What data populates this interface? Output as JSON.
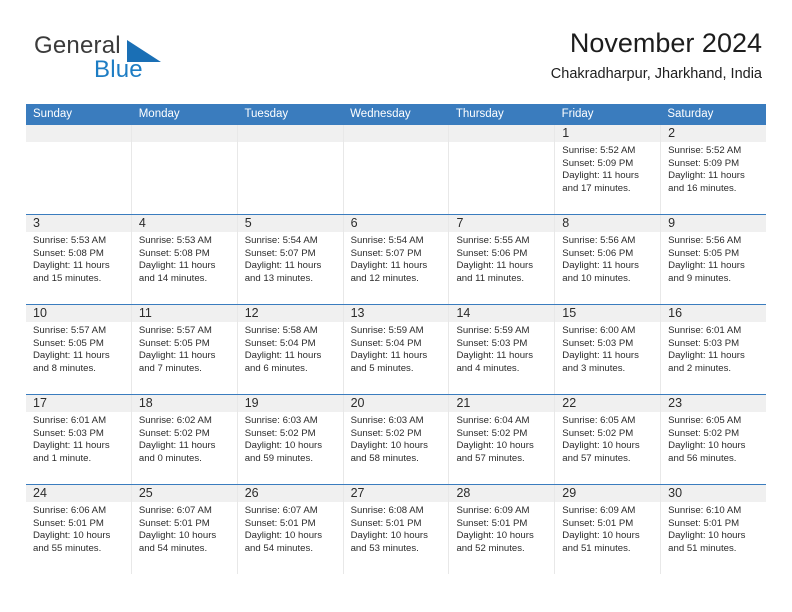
{
  "brand": {
    "word_general": "General",
    "word_blue": "Blue",
    "logo_icon": "triangle-icon"
  },
  "header": {
    "title": "November 2024",
    "subtitle": "Chakradharpur, Jharkhand, India"
  },
  "theme": {
    "header_blue": "#3a7cbe",
    "brand_blue": "#1d7dc4",
    "day_band_gray": "#f0f0f0",
    "cell_border": "#e8e8e8",
    "text": "#2b2b2b"
  },
  "weekdays": [
    "Sunday",
    "Monday",
    "Tuesday",
    "Wednesday",
    "Thursday",
    "Friday",
    "Saturday"
  ],
  "weeks": [
    [
      {
        "day": "",
        "sunrise": "",
        "sunset": "",
        "daylight1": "",
        "daylight2": ""
      },
      {
        "day": "",
        "sunrise": "",
        "sunset": "",
        "daylight1": "",
        "daylight2": ""
      },
      {
        "day": "",
        "sunrise": "",
        "sunset": "",
        "daylight1": "",
        "daylight2": ""
      },
      {
        "day": "",
        "sunrise": "",
        "sunset": "",
        "daylight1": "",
        "daylight2": ""
      },
      {
        "day": "",
        "sunrise": "",
        "sunset": "",
        "daylight1": "",
        "daylight2": ""
      },
      {
        "day": "1",
        "sunrise": "Sunrise: 5:52 AM",
        "sunset": "Sunset: 5:09 PM",
        "daylight1": "Daylight: 11 hours",
        "daylight2": "and 17 minutes."
      },
      {
        "day": "2",
        "sunrise": "Sunrise: 5:52 AM",
        "sunset": "Sunset: 5:09 PM",
        "daylight1": "Daylight: 11 hours",
        "daylight2": "and 16 minutes."
      }
    ],
    [
      {
        "day": "3",
        "sunrise": "Sunrise: 5:53 AM",
        "sunset": "Sunset: 5:08 PM",
        "daylight1": "Daylight: 11 hours",
        "daylight2": "and 15 minutes."
      },
      {
        "day": "4",
        "sunrise": "Sunrise: 5:53 AM",
        "sunset": "Sunset: 5:08 PM",
        "daylight1": "Daylight: 11 hours",
        "daylight2": "and 14 minutes."
      },
      {
        "day": "5",
        "sunrise": "Sunrise: 5:54 AM",
        "sunset": "Sunset: 5:07 PM",
        "daylight1": "Daylight: 11 hours",
        "daylight2": "and 13 minutes."
      },
      {
        "day": "6",
        "sunrise": "Sunrise: 5:54 AM",
        "sunset": "Sunset: 5:07 PM",
        "daylight1": "Daylight: 11 hours",
        "daylight2": "and 12 minutes."
      },
      {
        "day": "7",
        "sunrise": "Sunrise: 5:55 AM",
        "sunset": "Sunset: 5:06 PM",
        "daylight1": "Daylight: 11 hours",
        "daylight2": "and 11 minutes."
      },
      {
        "day": "8",
        "sunrise": "Sunrise: 5:56 AM",
        "sunset": "Sunset: 5:06 PM",
        "daylight1": "Daylight: 11 hours",
        "daylight2": "and 10 minutes."
      },
      {
        "day": "9",
        "sunrise": "Sunrise: 5:56 AM",
        "sunset": "Sunset: 5:05 PM",
        "daylight1": "Daylight: 11 hours",
        "daylight2": "and 9 minutes."
      }
    ],
    [
      {
        "day": "10",
        "sunrise": "Sunrise: 5:57 AM",
        "sunset": "Sunset: 5:05 PM",
        "daylight1": "Daylight: 11 hours",
        "daylight2": "and 8 minutes."
      },
      {
        "day": "11",
        "sunrise": "Sunrise: 5:57 AM",
        "sunset": "Sunset: 5:05 PM",
        "daylight1": "Daylight: 11 hours",
        "daylight2": "and 7 minutes."
      },
      {
        "day": "12",
        "sunrise": "Sunrise: 5:58 AM",
        "sunset": "Sunset: 5:04 PM",
        "daylight1": "Daylight: 11 hours",
        "daylight2": "and 6 minutes."
      },
      {
        "day": "13",
        "sunrise": "Sunrise: 5:59 AM",
        "sunset": "Sunset: 5:04 PM",
        "daylight1": "Daylight: 11 hours",
        "daylight2": "and 5 minutes."
      },
      {
        "day": "14",
        "sunrise": "Sunrise: 5:59 AM",
        "sunset": "Sunset: 5:03 PM",
        "daylight1": "Daylight: 11 hours",
        "daylight2": "and 4 minutes."
      },
      {
        "day": "15",
        "sunrise": "Sunrise: 6:00 AM",
        "sunset": "Sunset: 5:03 PM",
        "daylight1": "Daylight: 11 hours",
        "daylight2": "and 3 minutes."
      },
      {
        "day": "16",
        "sunrise": "Sunrise: 6:01 AM",
        "sunset": "Sunset: 5:03 PM",
        "daylight1": "Daylight: 11 hours",
        "daylight2": "and 2 minutes."
      }
    ],
    [
      {
        "day": "17",
        "sunrise": "Sunrise: 6:01 AM",
        "sunset": "Sunset: 5:03 PM",
        "daylight1": "Daylight: 11 hours",
        "daylight2": "and 1 minute."
      },
      {
        "day": "18",
        "sunrise": "Sunrise: 6:02 AM",
        "sunset": "Sunset: 5:02 PM",
        "daylight1": "Daylight: 11 hours",
        "daylight2": "and 0 minutes."
      },
      {
        "day": "19",
        "sunrise": "Sunrise: 6:03 AM",
        "sunset": "Sunset: 5:02 PM",
        "daylight1": "Daylight: 10 hours",
        "daylight2": "and 59 minutes."
      },
      {
        "day": "20",
        "sunrise": "Sunrise: 6:03 AM",
        "sunset": "Sunset: 5:02 PM",
        "daylight1": "Daylight: 10 hours",
        "daylight2": "and 58 minutes."
      },
      {
        "day": "21",
        "sunrise": "Sunrise: 6:04 AM",
        "sunset": "Sunset: 5:02 PM",
        "daylight1": "Daylight: 10 hours",
        "daylight2": "and 57 minutes."
      },
      {
        "day": "22",
        "sunrise": "Sunrise: 6:05 AM",
        "sunset": "Sunset: 5:02 PM",
        "daylight1": "Daylight: 10 hours",
        "daylight2": "and 57 minutes."
      },
      {
        "day": "23",
        "sunrise": "Sunrise: 6:05 AM",
        "sunset": "Sunset: 5:02 PM",
        "daylight1": "Daylight: 10 hours",
        "daylight2": "and 56 minutes."
      }
    ],
    [
      {
        "day": "24",
        "sunrise": "Sunrise: 6:06 AM",
        "sunset": "Sunset: 5:01 PM",
        "daylight1": "Daylight: 10 hours",
        "daylight2": "and 55 minutes."
      },
      {
        "day": "25",
        "sunrise": "Sunrise: 6:07 AM",
        "sunset": "Sunset: 5:01 PM",
        "daylight1": "Daylight: 10 hours",
        "daylight2": "and 54 minutes."
      },
      {
        "day": "26",
        "sunrise": "Sunrise: 6:07 AM",
        "sunset": "Sunset: 5:01 PM",
        "daylight1": "Daylight: 10 hours",
        "daylight2": "and 54 minutes."
      },
      {
        "day": "27",
        "sunrise": "Sunrise: 6:08 AM",
        "sunset": "Sunset: 5:01 PM",
        "daylight1": "Daylight: 10 hours",
        "daylight2": "and 53 minutes."
      },
      {
        "day": "28",
        "sunrise": "Sunrise: 6:09 AM",
        "sunset": "Sunset: 5:01 PM",
        "daylight1": "Daylight: 10 hours",
        "daylight2": "and 52 minutes."
      },
      {
        "day": "29",
        "sunrise": "Sunrise: 6:09 AM",
        "sunset": "Sunset: 5:01 PM",
        "daylight1": "Daylight: 10 hours",
        "daylight2": "and 51 minutes."
      },
      {
        "day": "30",
        "sunrise": "Sunrise: 6:10 AM",
        "sunset": "Sunset: 5:01 PM",
        "daylight1": "Daylight: 10 hours",
        "daylight2": "and 51 minutes."
      }
    ]
  ]
}
